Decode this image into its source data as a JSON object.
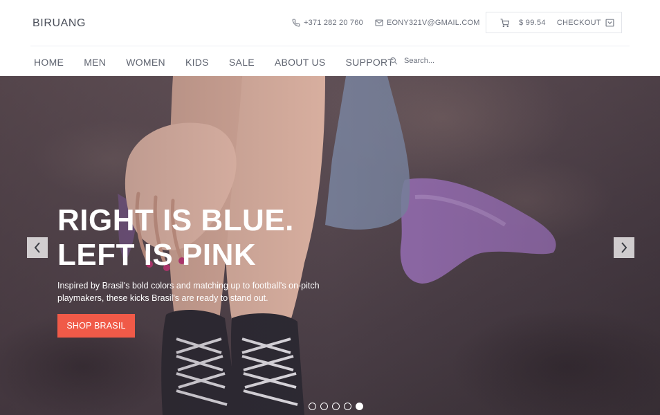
{
  "brand": "BIRUANG",
  "header": {
    "phone": "+371 282 20 760",
    "email": "EONY321V@GMAIL.COM",
    "cart_total": "$ 99.54",
    "checkout_label": "CHECKOUT"
  },
  "nav": {
    "items": [
      "HOME",
      "MEN",
      "WOMEN",
      "KIDS",
      "SALE",
      "ABOUT US",
      "SUPPORT"
    ],
    "search_placeholder": "Search..."
  },
  "hero": {
    "title_line1": "RIGHT IS BLUE.",
    "title_line2": "LEFT IS PINK",
    "description_line1": "Inspired by Brasil's bold colors and matching up to football's on-pitch",
    "description_line2": "playmakers, these kicks Brasil's are ready to stand out.",
    "button_label": "SHOP BRASIL",
    "slides": 5,
    "active_slide": 5
  },
  "colors": {
    "accent": "#f05a48",
    "text": "#5f6470",
    "border": "#e3e5ea"
  },
  "icons": [
    "phone-icon",
    "mail-icon",
    "cart-icon",
    "checkout-icon",
    "search-icon",
    "chevron-left-icon",
    "chevron-right-icon"
  ]
}
